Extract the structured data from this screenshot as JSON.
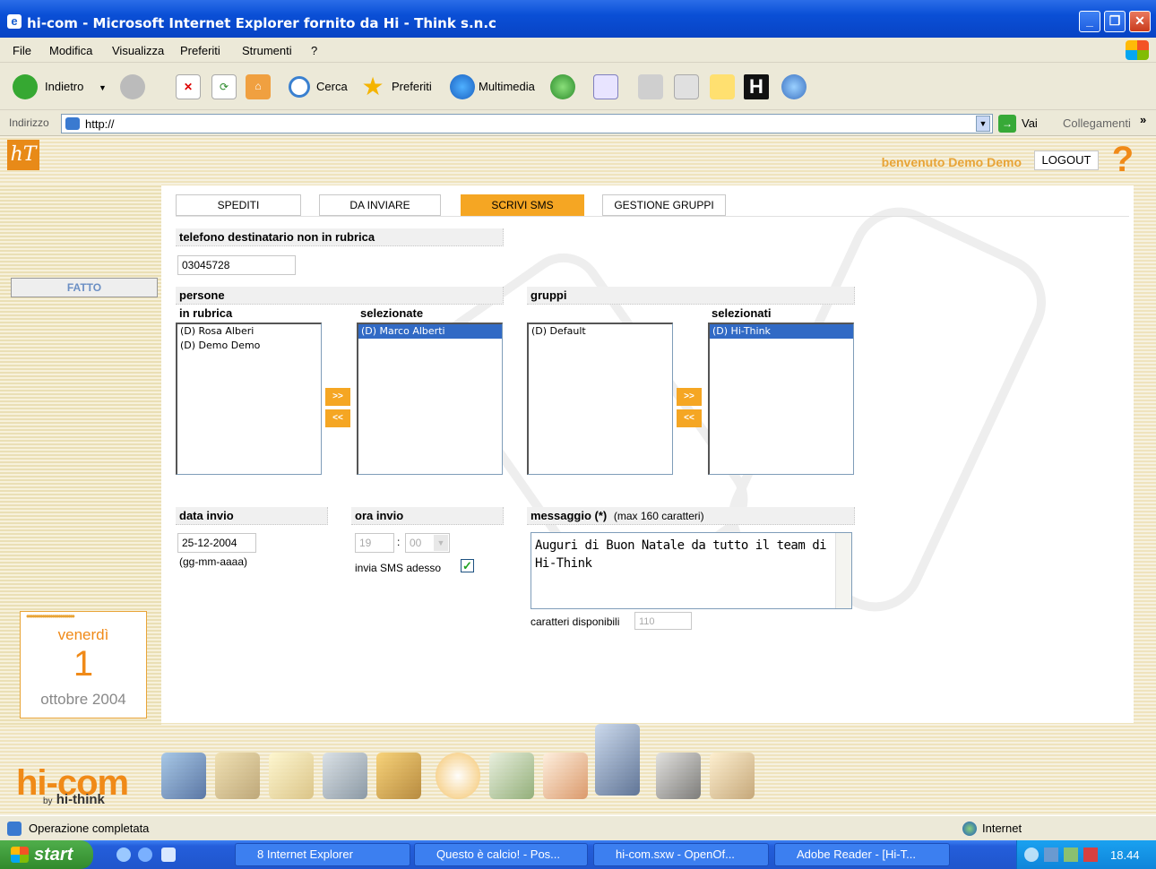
{
  "window": {
    "title": "hi-com - Microsoft Internet Explorer fornito da Hi - Think s.n.c"
  },
  "menu": [
    "File",
    "Modifica",
    "Visualizza",
    "Preferiti",
    "Strumenti",
    "?"
  ],
  "toolbar": {
    "back": "Indietro",
    "search": "Cerca",
    "favorites": "Preferiti",
    "media": "Multimedia"
  },
  "address": {
    "label": "Indirizzo",
    "url": "http://",
    "go": "Vai",
    "links": "Collegamenti"
  },
  "header": {
    "welcome": "benvenuto Demo Demo",
    "logout": "LOGOUT"
  },
  "sidebar": {
    "done": "FATTO"
  },
  "calendar": {
    "weekday": "venerdì",
    "day": "1",
    "month_year": "ottobre 2004"
  },
  "tabs": [
    "SPEDITI",
    "DA INVIARE",
    "SCRIVI SMS",
    "GESTIONE GRUPPI"
  ],
  "form": {
    "phone_header": "telefono destinatario non in rubrica",
    "phone_value": "03045728",
    "people_header": "persone",
    "in_rubrica": "in rubrica",
    "selected_label": "selezionate",
    "groups_header": "gruppi",
    "groups_selected_label": "selezionati",
    "people_available": [
      "(D) Rosa Alberi",
      "(D) Demo Demo"
    ],
    "people_selected": [
      "(D) Marco Alberti"
    ],
    "groups_available": [
      "(D) Default"
    ],
    "groups_selected": [
      "(D) Hi-Think"
    ],
    "add": ">>",
    "remove": "<<",
    "date_header": "data invio",
    "date_value": "25-12-2004",
    "date_hint": "(gg-mm-aaaa)",
    "time_header": "ora invio",
    "hour": "19",
    "minute": "00",
    "send_now": "invia SMS adesso",
    "message_header": "messaggio (*)",
    "message_hint": "(max 160 caratteri)",
    "message": "Auguri di Buon Natale da tutto il team di Hi-Think",
    "chars_label": "caratteri disponibili",
    "chars_value": "110"
  },
  "branding": {
    "logo": "hi-com",
    "by": "by",
    "company": "hi-think"
  },
  "status": {
    "text": "Operazione completata",
    "zone": "Internet"
  },
  "taskbar": {
    "start": "start",
    "tasks": [
      "8 Internet Explorer",
      "Questo è calcio! - Pos...",
      "hi-com.sxw - OpenOf...",
      "Adobe Reader - [Hi-T..."
    ],
    "clock": "18.44"
  }
}
